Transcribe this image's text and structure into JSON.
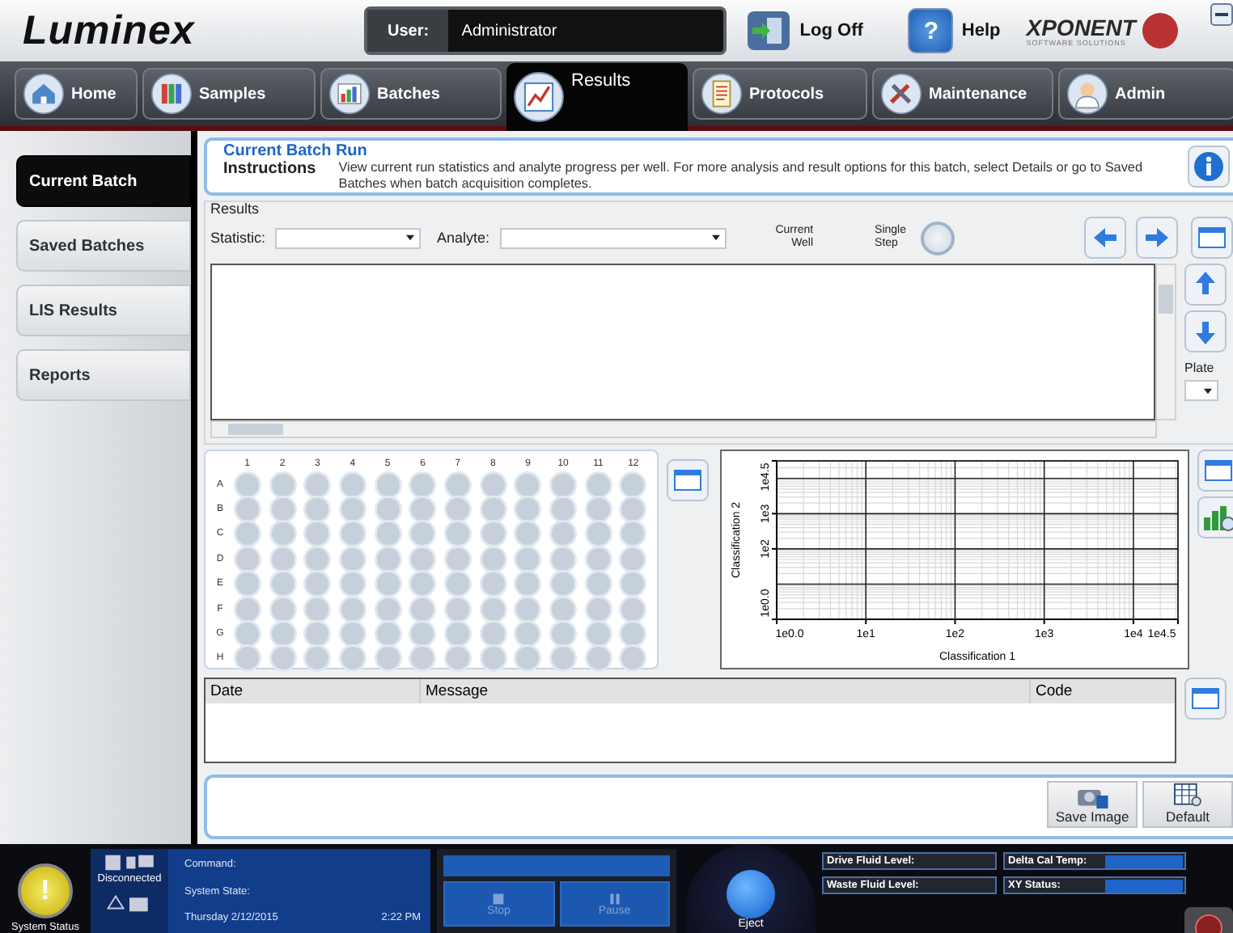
{
  "header": {
    "logo": "Luminex",
    "user_label": "User:",
    "user": "Administrator",
    "logoff": "Log Off",
    "help_glyph": "?",
    "help": "Help",
    "brand": "XPONENT",
    "brand_sub": "SOFTWARE SOLUTIONS"
  },
  "nav": [
    {
      "label": "Home",
      "kind": "home",
      "selected": false
    },
    {
      "label": "Samples",
      "kind": "samples",
      "selected": false
    },
    {
      "label": "Batches",
      "kind": "batches",
      "selected": false
    },
    {
      "label": "Results",
      "kind": "results",
      "selected": true
    },
    {
      "label": "Protocols",
      "kind": "protocols",
      "selected": false
    },
    {
      "label": "Maintenance",
      "kind": "maintenance",
      "selected": false
    },
    {
      "label": "Admin",
      "kind": "admin",
      "selected": false
    }
  ],
  "sidebar": [
    {
      "label": "Current Batch",
      "selected": true
    },
    {
      "label": "Saved Batches",
      "selected": false
    },
    {
      "label": "LIS Results",
      "selected": false
    },
    {
      "label": "Reports",
      "selected": false
    }
  ],
  "instructions": {
    "title": "Current Batch Run",
    "label": "Instructions",
    "text": "View current run statistics and analyte progress per well. For more analysis and result options for this batch, select Details or go to Saved Batches when batch acquisition completes."
  },
  "results": {
    "legend": "Results",
    "statistic_label": "Statistic:",
    "analyte_label": "Analyte:",
    "current_well": "Current Well",
    "single_step": "Single Step",
    "single_step_on": false,
    "plate_label": "Plate"
  },
  "plate": {
    "columns": [
      "1",
      "2",
      "3",
      "4",
      "5",
      "6",
      "7",
      "8",
      "9",
      "10",
      "11",
      "12"
    ],
    "rows": [
      "A",
      "B",
      "C",
      "D",
      "E",
      "F",
      "G",
      "H"
    ]
  },
  "chart": {
    "xlabel": "Classification 1",
    "ylabel": "Classification 2",
    "x_tick_labels": [
      "1e0.0",
      "1e1",
      "1e2",
      "1e3",
      "1e4",
      "1e4.5"
    ],
    "y_tick_labels": [
      "1e0.0",
      "1e2",
      "1e3",
      "1e4.5"
    ]
  },
  "messages": {
    "columns": [
      "Date",
      "Message",
      "Code"
    ]
  },
  "buttons": [
    {
      "label": "Save Image",
      "kind": "camera"
    },
    {
      "label": "Default",
      "kind": "grid"
    }
  ],
  "status": {
    "system_status_glyph": "!",
    "system_status": "System Status",
    "connection": "Disconnected",
    "command": "Command:",
    "system_state": "System State:",
    "date": "Thursday 2/12/2015",
    "time": "2:22 PM",
    "progress": {
      "level": 0
    },
    "controls": [
      {
        "label": "Stop",
        "kind": "stop",
        "disabled": true
      },
      {
        "label": "Pause",
        "kind": "pause",
        "disabled": true
      }
    ],
    "eject": "Eject",
    "fluids": [
      "Drive Fluid Level:",
      "Waste Fluid Level:"
    ],
    "sensors": [
      "Delta Cal Temp:",
      "XY Status:"
    ]
  }
}
